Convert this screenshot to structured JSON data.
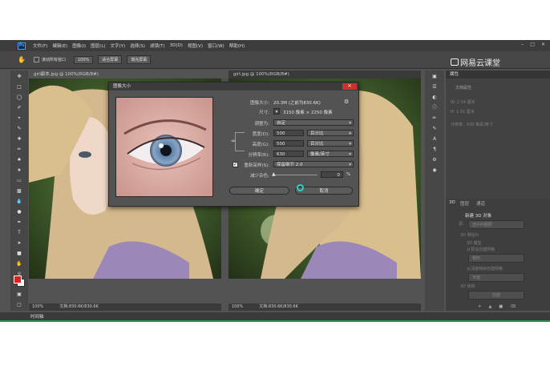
{
  "menubar": {
    "logo": "Ps",
    "items": [
      "文件(F)",
      "编辑(E)",
      "图像(I)",
      "图层(L)",
      "文字(Y)",
      "选择(S)",
      "滤镜(T)",
      "3D(D)",
      "视图(V)",
      "窗口(W)",
      "帮助(H)"
    ]
  },
  "options_bar": {
    "scroll_all": "滚动所有窗口",
    "zoom": "100%",
    "fit_screen": "适合屏幕",
    "fill_screen": "填充屏幕"
  },
  "documents": [
    {
      "tab": "girl副本.jpg @ 100%(RGB/8#)",
      "zoom": "100%",
      "doc_info": "文档:830.6K/830.6K"
    },
    {
      "tab": "girl.jpg @ 100%(RGB/8#)",
      "zoom": "100%",
      "doc_info": "文档:830.6K/830.6K"
    }
  ],
  "watermark": "网易云课堂",
  "dialog": {
    "title": "图像大小",
    "close": "✕",
    "image_size_label": "图像大小:",
    "image_size_value": "20.3M (之前为830.6K)",
    "dimensions_label": "尺寸:",
    "dimensions_value": "3150 像素 × 2250 像素",
    "fit_label": "调整为:",
    "fit_value": "自定",
    "width_label": "宽度(D):",
    "width_value": "500",
    "width_unit": "百分比",
    "height_label": "高度(G):",
    "height_value": "500",
    "height_unit": "百分比",
    "resolution_label": "分辨率(R):",
    "resolution_value": "630",
    "resolution_unit": "像素/英寸",
    "resample_label": "重新采样(S):",
    "resample_value": "保留细节 2.0",
    "noise_label": "减少杂色:",
    "noise_value": "0",
    "noise_unit": "%",
    "ok": "确定",
    "cancel": "取消"
  },
  "properties_panel": {
    "tab": "属性",
    "doc_props": "文档属性",
    "w": "W: 2.54 厘米",
    "h": "H: 1.91 厘米",
    "res": "分辨率：630 像素/英寸"
  },
  "panel_3d": {
    "tabs": [
      "3D",
      "图层",
      "通道"
    ],
    "new_3d": "新建 3D 对象",
    "source": "源：",
    "selected_layer": "选中的图层",
    "postcard": "3D 明信片",
    "model": "3D 模型",
    "from_preset": "从预设创建网格",
    "preset_value": "帽形",
    "from_depth": "从深度映射创建网格",
    "depth_value": "平面",
    "volume": "3D 体积",
    "create": "创建"
  },
  "timeline": "时间轴",
  "colors": {
    "foreground": "#e21e1e",
    "background": "#ffffff",
    "accent": "#1b9e57"
  }
}
